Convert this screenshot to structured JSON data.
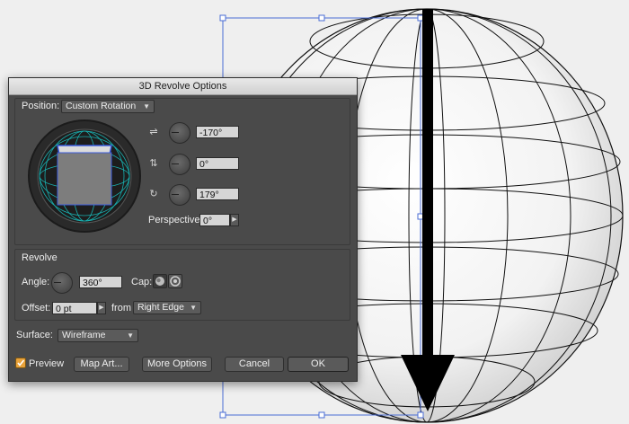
{
  "dialog": {
    "title": "3D Revolve Options",
    "position_label": "Position:",
    "position_value": "Custom Rotation",
    "rot_x": "-170°",
    "rot_y": "0°",
    "rot_z": "179°",
    "perspective_label": "Perspective:",
    "perspective_value": "0°",
    "revolve_heading": "Revolve",
    "angle_label": "Angle:",
    "angle_value": "360°",
    "cap_label": "Cap:",
    "offset_label": "Offset:",
    "offset_value": "0 pt",
    "from_label": "from",
    "from_value": "Right Edge",
    "surface_label": "Surface:",
    "surface_value": "Wireframe",
    "preview_label": "Preview",
    "preview_checked": true,
    "buttons": {
      "map_art": "Map Art...",
      "more_options": "More Options",
      "cancel": "Cancel",
      "ok": "OK"
    }
  },
  "colors": {
    "dialog_bg": "#4a4a4a",
    "selection_blue": "#4a6cd4",
    "cube_edge": "#3b5bdb",
    "track_grid": "#19b0b0"
  },
  "icons": {
    "x_axis": "rotate-x-icon",
    "y_axis": "rotate-y-icon",
    "z_axis": "rotate-z-icon",
    "cap_on": "cap-on-icon",
    "cap_off": "cap-off-icon",
    "checkbox": "checkbox-icon"
  }
}
